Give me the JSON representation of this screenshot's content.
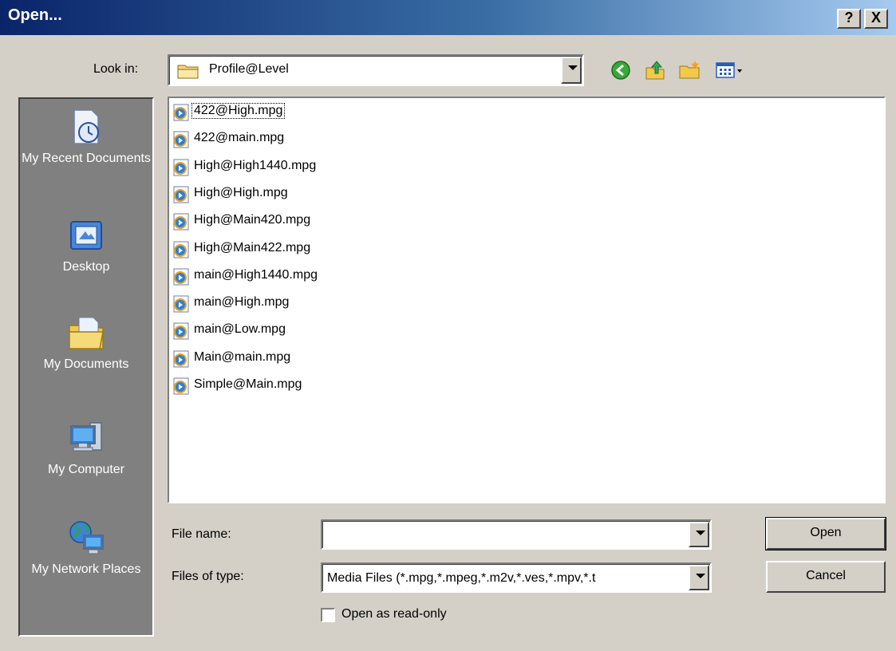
{
  "window": {
    "title": "Open...",
    "help_label": "?",
    "close_label": "X"
  },
  "lookin": {
    "label": "Look in:",
    "value": "Profile@Level",
    "folder_icon": "folder-icon"
  },
  "toolbar": {
    "back_icon": "back-icon",
    "up_icon": "up-folder-icon",
    "new_folder_icon": "new-folder-icon",
    "views_icon": "views-menu-icon"
  },
  "places": [
    {
      "id": "recent",
      "label": "My Recent Documents",
      "icon": "recent-documents-icon"
    },
    {
      "id": "desktop",
      "label": "Desktop",
      "icon": "desktop-icon"
    },
    {
      "id": "documents",
      "label": "My Documents",
      "icon": "my-documents-icon"
    },
    {
      "id": "computer",
      "label": "My Computer",
      "icon": "my-computer-icon"
    },
    {
      "id": "network",
      "label": "My Network Places",
      "icon": "my-network-places-icon"
    }
  ],
  "files": [
    "422@High.mpg",
    "422@main.mpg",
    "High@High1440.mpg",
    "High@High.mpg",
    "High@Main420.mpg",
    "High@Main422.mpg",
    "main@High1440.mpg",
    "main@High.mpg",
    "main@Low.mpg",
    "Main@main.mpg",
    "Simple@Main.mpg"
  ],
  "form": {
    "filename_label": "File name:",
    "filename_value": "",
    "filetype_label": "Files of type:",
    "filetype_value": "Media Files (*.mpg,*.mpeg,*.m2v,*.ves,*.mpv,*.t",
    "readonly_label": "Open as read-only",
    "readonly_checked": false
  },
  "buttons": {
    "open": "Open",
    "cancel": "Cancel"
  },
  "colors": {
    "title_start": "#0a246a",
    "title_end": "#a6caf0",
    "face": "#d4d0c8",
    "places_bg": "#808080"
  }
}
